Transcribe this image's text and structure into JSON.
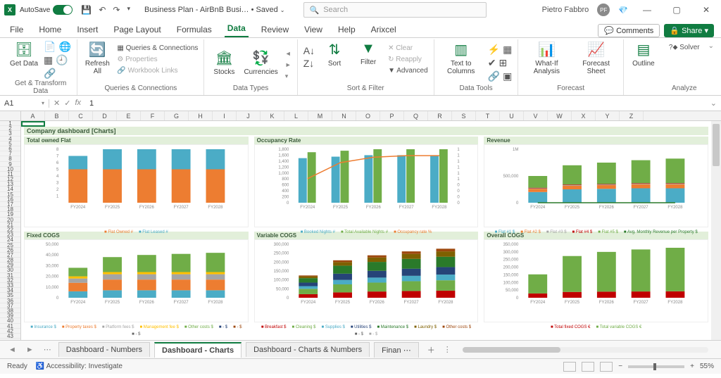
{
  "titlebar": {
    "autosave_label": "AutoSave",
    "autosave_state": "On",
    "doc_name": "Business Plan - AirBnB Busi…",
    "save_state": "Saved",
    "search_placeholder": "Search",
    "user_name": "Pietro Fabbro",
    "user_initials": "PF"
  },
  "tabs": {
    "file": "File",
    "home": "Home",
    "insert": "Insert",
    "page_layout": "Page Layout",
    "formulas": "Formulas",
    "data": "Data",
    "review": "Review",
    "view": "View",
    "help": "Help",
    "arixcel": "Arixcel",
    "comments": "Comments",
    "share": "Share"
  },
  "ribbon": {
    "get_data": "Get\nData",
    "refresh_all": "Refresh\nAll",
    "queries_connections": "Queries & Connections",
    "properties": "Properties",
    "workbook_links": "Workbook Links",
    "stocks": "Stocks",
    "currencies": "Currencies",
    "sort": "Sort",
    "filter": "Filter",
    "clear": "Clear",
    "reapply": "Reapply",
    "advanced": "Advanced",
    "text_to_columns": "Text to\nColumns",
    "whatif": "What-If\nAnalysis",
    "forecast_sheet": "Forecast\nSheet",
    "outline": "Outline",
    "solver": "Solver",
    "grp_transform": "Get & Transform Data",
    "grp_queries": "Queries & Connections",
    "grp_datatypes": "Data Types",
    "grp_sortfilter": "Sort & Filter",
    "grp_datatools": "Data Tools",
    "grp_forecast": "Forecast",
    "grp_analyze": "Analyze"
  },
  "formula_bar": {
    "name_box": "A1",
    "value": "1"
  },
  "dashboard_title": "Company dashboard [Charts]",
  "charts": {
    "owned_flat": "Total owned Flat",
    "occupancy": "Occupancy Rate",
    "revenue": "Revenue",
    "fixed_cogs": "Fixed COGS",
    "variable_cogs": "Variable COGS",
    "overall_cogs": "Overall COGS"
  },
  "sheet_tabs": {
    "dash_numbers": "Dashboard - Numbers",
    "dash_charts": "Dashboard - Charts",
    "dash_both": "Dashboard - Charts & Numbers",
    "finan": "Finan"
  },
  "status": {
    "ready": "Ready",
    "accessibility": "Accessibility: Investigate",
    "zoom": "55%"
  },
  "chart_data": [
    {
      "name": "Total owned Flat",
      "type": "bar",
      "stacked": true,
      "categories": [
        "FY2024",
        "FY2025",
        "FY2026",
        "FY2027",
        "FY2028"
      ],
      "series": [
        {
          "name": "Flat Owned #",
          "color": "#ed7d31",
          "values": [
            5,
            5,
            5,
            5,
            5
          ]
        },
        {
          "name": "Flat Leased #",
          "color": "#4bacc6",
          "values": [
            2,
            3,
            3,
            3,
            3
          ]
        }
      ],
      "ylim": [
        0,
        8
      ],
      "yticks": [
        1,
        2,
        3,
        4,
        5,
        6,
        7,
        8
      ]
    },
    {
      "name": "Occupancy Rate",
      "type": "combo",
      "categories": [
        "FY2024",
        "FY2025",
        "FY2026",
        "FY2027",
        "FY2028"
      ],
      "series": [
        {
          "name": "Booked Nights #",
          "type": "bar",
          "color": "#4bacc6",
          "values": [
            1500,
            1550,
            1600,
            1600,
            1600
          ]
        },
        {
          "name": "Total Available Nights #",
          "type": "bar",
          "color": "#70ad47",
          "values": [
            1700,
            1750,
            1800,
            1800,
            1800
          ]
        },
        {
          "name": "Occupancy rate %",
          "type": "line",
          "color": "#ed7d31",
          "axis": "right",
          "values": [
            0.45,
            0.75,
            0.85,
            0.88,
            0.88
          ]
        }
      ],
      "ylim": [
        0,
        1800
      ],
      "yticks": [
        0,
        200,
        400,
        600,
        800,
        1000,
        1200,
        1400,
        1600,
        1800
      ],
      "y2lim": [
        0,
        1
      ],
      "y2ticks": [
        0,
        0,
        0,
        0,
        1,
        1,
        1,
        1,
        1,
        1
      ]
    },
    {
      "name": "Revenue",
      "type": "bar",
      "stacked": true,
      "categories": [
        "FY2024",
        "FY2025",
        "FY2026",
        "FY2027",
        "FY2028"
      ],
      "series": [
        {
          "name": "Flat #1 $",
          "color": "#4bacc6",
          "values": [
            200000,
            250000,
            260000,
            270000,
            270000
          ]
        },
        {
          "name": "Flat #2 $",
          "color": "#ed7d31",
          "values": [
            60000,
            70000,
            70000,
            75000,
            75000
          ]
        },
        {
          "name": "Flat #3 $",
          "color": "#a5a5a5",
          "values": [
            10000,
            10000,
            10000,
            10000,
            10000
          ]
        },
        {
          "name": "Flat #4 $",
          "color": "#c00000",
          "values": [
            10000,
            10000,
            10000,
            10000,
            10000
          ]
        },
        {
          "name": "Flat #5 $",
          "color": "#70ad47",
          "values": [
            220000,
            360000,
            400000,
            430000,
            460000
          ]
        },
        {
          "name": "Avg. Monthly Revenue per Property $",
          "type": "line",
          "color": "#2a7a2a",
          "values": [
            0,
            0,
            0,
            0,
            0
          ]
        }
      ],
      "ylim": [
        0,
        1000000
      ],
      "yticks": [
        0,
        500000,
        1000000
      ]
    },
    {
      "name": "Fixed COGS",
      "type": "bar",
      "stacked": true,
      "categories": [
        "FY2024",
        "FY2025",
        "FY2026",
        "FY2027",
        "FY2028"
      ],
      "series": [
        {
          "name": "Insurance $",
          "color": "#4bacc6",
          "values": [
            6000,
            7000,
            7000,
            7000,
            7000
          ]
        },
        {
          "name": "Property taxes $",
          "color": "#ed7d31",
          "values": [
            8000,
            10000,
            10000,
            10000,
            10000
          ]
        },
        {
          "name": "Platform fees $",
          "color": "#a5a5a5",
          "values": [
            4000,
            5000,
            5000,
            5000,
            5000
          ]
        },
        {
          "name": "Management fee $",
          "color": "#ffc000",
          "values": [
            2000,
            2000,
            2000,
            2000,
            2000
          ]
        },
        {
          "name": "Other costs $",
          "color": "#70ad47",
          "values": [
            8000,
            14000,
            16000,
            17000,
            18000
          ]
        },
        {
          "name": "- $",
          "color": "#264478",
          "values": [
            0,
            0,
            0,
            0,
            0
          ]
        },
        {
          "name": "- $",
          "color": "#9e480e",
          "values": [
            0,
            0,
            0,
            0,
            0
          ]
        },
        {
          "name": "- $",
          "color": "#636363",
          "values": [
            0,
            0,
            0,
            0,
            0
          ]
        }
      ],
      "ylim": [
        0,
        50000
      ],
      "yticks": [
        0,
        10000,
        20000,
        30000,
        40000,
        50000
      ]
    },
    {
      "name": "Variable COGS",
      "type": "bar",
      "stacked": true,
      "categories": [
        "FY2024",
        "FY2025",
        "FY2026",
        "FY2027",
        "FY2028"
      ],
      "series": [
        {
          "name": "Breakfast $",
          "color": "#c00000",
          "values": [
            20000,
            30000,
            35000,
            38000,
            40000
          ]
        },
        {
          "name": "Cleaning $",
          "color": "#70ad47",
          "values": [
            30000,
            45000,
            50000,
            55000,
            58000
          ]
        },
        {
          "name": "Supplies $",
          "color": "#4bacc6",
          "values": [
            15000,
            25000,
            28000,
            30000,
            32000
          ]
        },
        {
          "name": "Utilities $",
          "color": "#264478",
          "values": [
            20000,
            35000,
            38000,
            40000,
            42000
          ]
        },
        {
          "name": "Maintenance $",
          "color": "#2a7a2a",
          "values": [
            25000,
            45000,
            50000,
            55000,
            58000
          ]
        },
        {
          "name": "Laundry $",
          "color": "#7f6000",
          "values": [
            10000,
            20000,
            25000,
            28000,
            30000
          ]
        },
        {
          "name": "Other costs $",
          "color": "#9e480e",
          "values": [
            5000,
            10000,
            12000,
            14000,
            15000
          ]
        },
        {
          "name": "- $",
          "color": "#636363",
          "values": [
            0,
            0,
            0,
            0,
            0
          ]
        },
        {
          "name": "- $",
          "color": "#a5a5a5",
          "values": [
            0,
            0,
            0,
            0,
            0
          ]
        }
      ],
      "ylim": [
        0,
        300000
      ],
      "yticks": [
        0,
        50000,
        100000,
        150000,
        200000,
        250000,
        300000
      ]
    },
    {
      "name": "Overall COGS",
      "type": "bar",
      "stacked": true,
      "categories": [
        "FY2024",
        "FY2025",
        "FY2026",
        "FY2027",
        "FY2028"
      ],
      "series": [
        {
          "name": "Total fixed COGS €",
          "color": "#c00000",
          "values": [
            28000,
            38000,
            40000,
            41000,
            42000
          ]
        },
        {
          "name": "Total variable COGS €",
          "color": "#70ad47",
          "values": [
            125000,
            235000,
            260000,
            275000,
            285000
          ]
        }
      ],
      "ylim": [
        0,
        350000
      ],
      "yticks": [
        0,
        50000,
        100000,
        150000,
        200000,
        250000,
        300000,
        350000
      ]
    }
  ]
}
